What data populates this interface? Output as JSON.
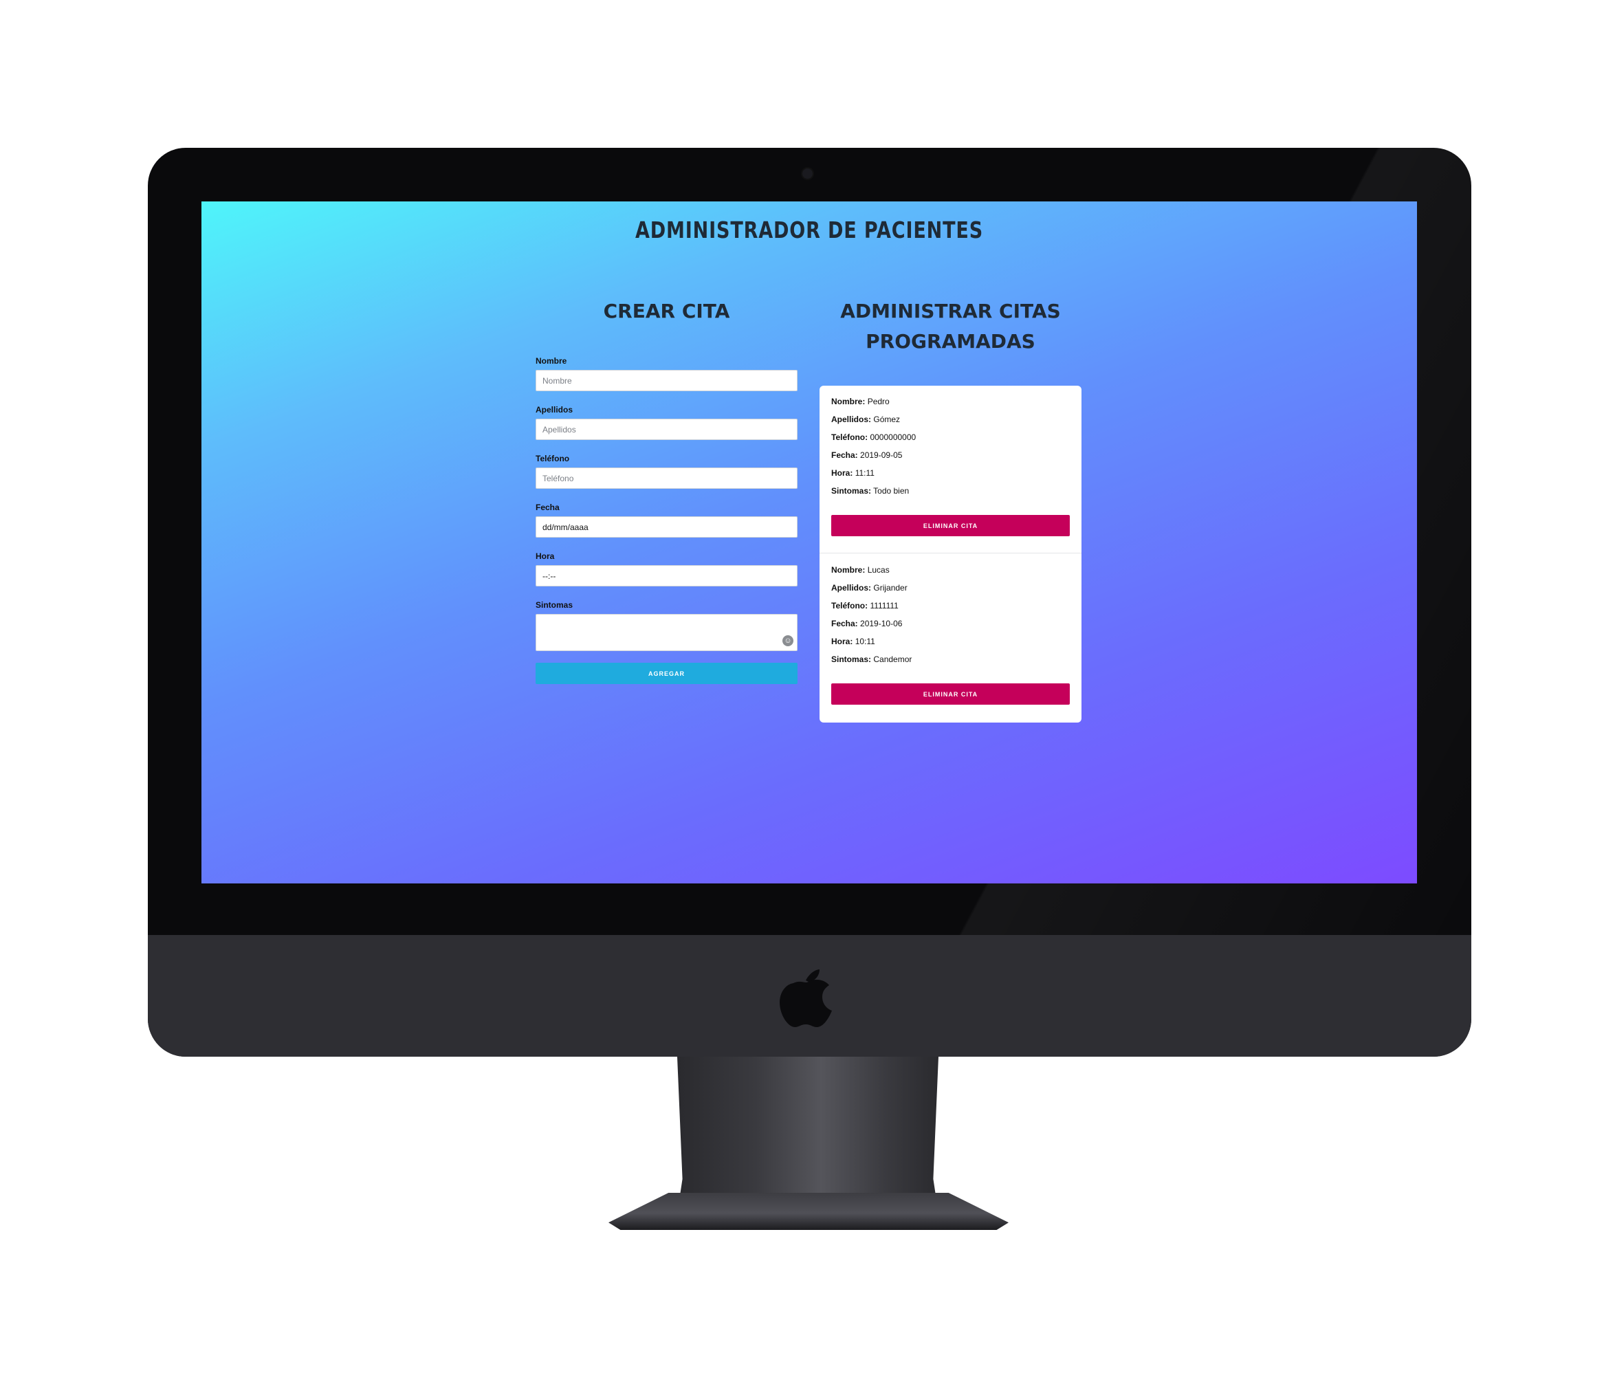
{
  "app": {
    "title": "Administrador de Pacientes"
  },
  "form": {
    "heading": "Crear Cita",
    "fields": {
      "nombre": {
        "label": "Nombre",
        "placeholder": "Nombre",
        "value": ""
      },
      "apellidos": {
        "label": "Apellidos",
        "placeholder": "Apellidos",
        "value": ""
      },
      "telefono": {
        "label": "Teléfono",
        "placeholder": "Teléfono",
        "value": ""
      },
      "fecha": {
        "label": "Fecha",
        "value": "dd/mm/aaaa"
      },
      "hora": {
        "label": "Hora",
        "value": "--:--"
      },
      "sintomas": {
        "label": "Sintomas",
        "value": ""
      }
    },
    "submit_label": "Agregar",
    "submit_color": "#1fabde"
  },
  "list": {
    "heading_line1": "Administrar Citas",
    "heading_line2": "Programadas",
    "labels": {
      "nombre": "Nombre:",
      "apellidos": "Apellidos:",
      "telefono": "Teléfono:",
      "fecha": "Fecha:",
      "hora": "Hora:",
      "sintomas": "Sintomas:"
    },
    "delete_label": "Eliminar Cita",
    "delete_color": "#c5005a",
    "citas": [
      {
        "nombre": "Pedro",
        "apellidos": "Gómez",
        "telefono": "0000000000",
        "fecha": "2019-09-05",
        "hora": "11:11",
        "sintomas": "Todo bien"
      },
      {
        "nombre": "Lucas",
        "apellidos": "Grijander",
        "telefono": "1111111",
        "fecha": "2019-10-06",
        "hora": "10:11",
        "sintomas": "Candemor"
      }
    ]
  },
  "device": {
    "logo_icon": "apple-logo-icon",
    "emoji_icon": "emoji-icon"
  }
}
